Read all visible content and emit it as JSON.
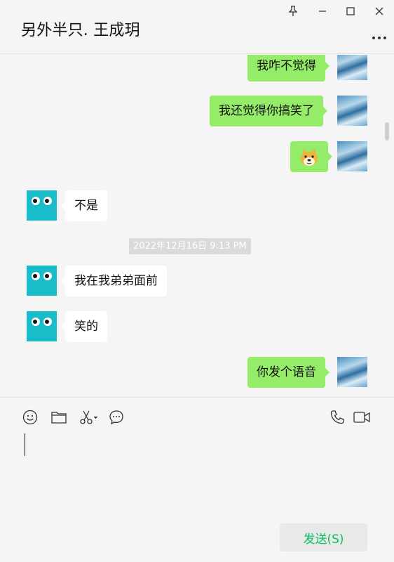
{
  "chat": {
    "title": "另外半只. 王成玥",
    "timestamp": "2022年12月16日 9:13 PM"
  },
  "messages": [
    {
      "side": "me",
      "text": "我咋不觉得"
    },
    {
      "side": "me",
      "text": "我还觉得你搞笑了"
    },
    {
      "side": "me",
      "text": "",
      "sticker": "doge-emoji"
    },
    {
      "side": "other",
      "text": "不是"
    },
    {
      "side": "other",
      "text": "我在我弟弟面前"
    },
    {
      "side": "other",
      "text": "笑的"
    },
    {
      "side": "me",
      "text": "你发个语音"
    }
  ],
  "toolbar": {
    "icons": [
      "emoji-icon",
      "folder-icon",
      "scissors-icon",
      "chat-history-icon",
      "phone-icon",
      "video-call-icon"
    ]
  },
  "composer": {
    "send_label": "发送(S)"
  },
  "colors": {
    "my_bubble": "#95ec69",
    "other_bubble": "#ffffff",
    "send_text": "#07c160",
    "background": "#f5f5f5"
  }
}
